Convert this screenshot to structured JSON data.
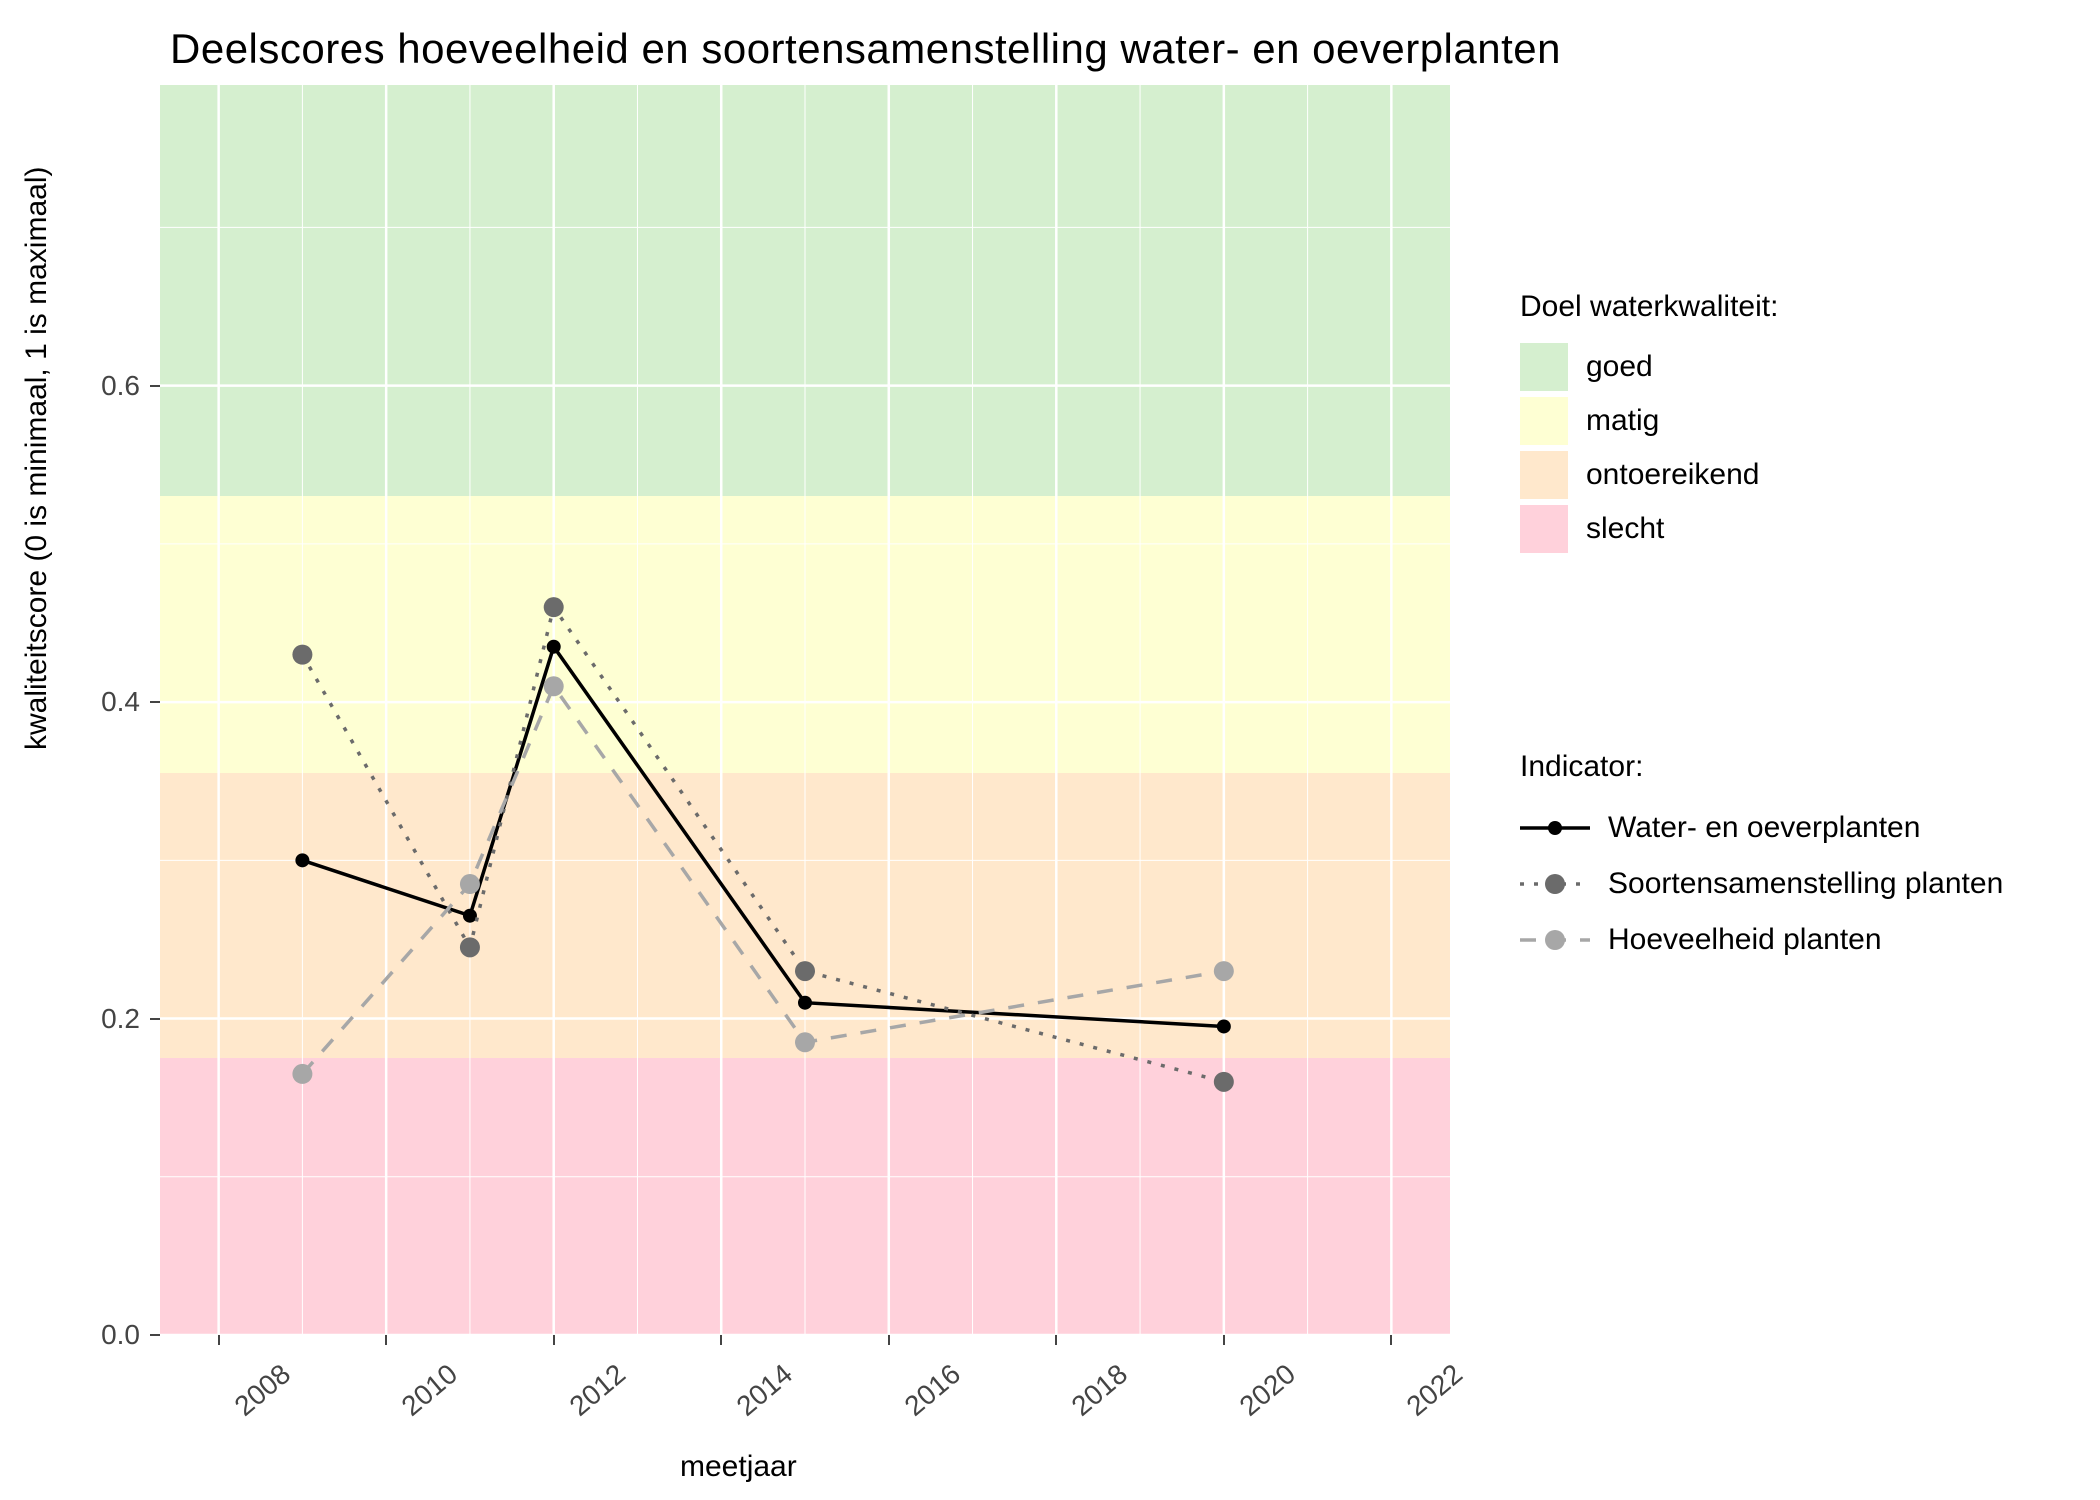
{
  "chart_data": {
    "type": "line",
    "title": "Deelscores hoeveelheid en soortensamenstelling water- en oeverplanten",
    "xlabel": "meetjaar",
    "ylabel": "kwaliteitscore (0 is minimaal, 1 is maximaal)",
    "ylim": [
      0.0,
      0.79
    ],
    "xlim": [
      2007.3,
      2022.7
    ],
    "x_ticks": [
      2008,
      2010,
      2012,
      2014,
      2016,
      2018,
      2020,
      2022
    ],
    "y_ticks": [
      0.0,
      0.2,
      0.4,
      0.6
    ],
    "bands": [
      {
        "name": "goed",
        "from": 0.53,
        "to": 0.8,
        "color": "#d5efcf"
      },
      {
        "name": "matig",
        "from": 0.355,
        "to": 0.53,
        "color": "#feffd3"
      },
      {
        "name": "ontoereikend",
        "from": 0.175,
        "to": 0.355,
        "color": "#ffe8cc"
      },
      {
        "name": "slecht",
        "from": 0.0,
        "to": 0.175,
        "color": "#ffd1db"
      }
    ],
    "x": [
      2009,
      2011,
      2012,
      2015,
      2020
    ],
    "series": [
      {
        "name": "Water- en oeverplanten",
        "values": [
          0.3,
          0.265,
          0.435,
          0.21,
          0.195
        ],
        "color": "#000000",
        "dash": "solid"
      },
      {
        "name": "Soortensamenstelling planten",
        "values": [
          0.43,
          0.245,
          0.46,
          0.23,
          0.16
        ],
        "color": "#6b6b6b",
        "dash": "dotted"
      },
      {
        "name": "Hoeveelheid planten",
        "values": [
          0.165,
          0.285,
          0.41,
          0.185,
          0.23
        ],
        "color": "#a7a7a7",
        "dash": "dashed"
      }
    ],
    "legend_band_title": "Doel waterkwaliteit:",
    "legend_series_title": "Indicator:"
  }
}
